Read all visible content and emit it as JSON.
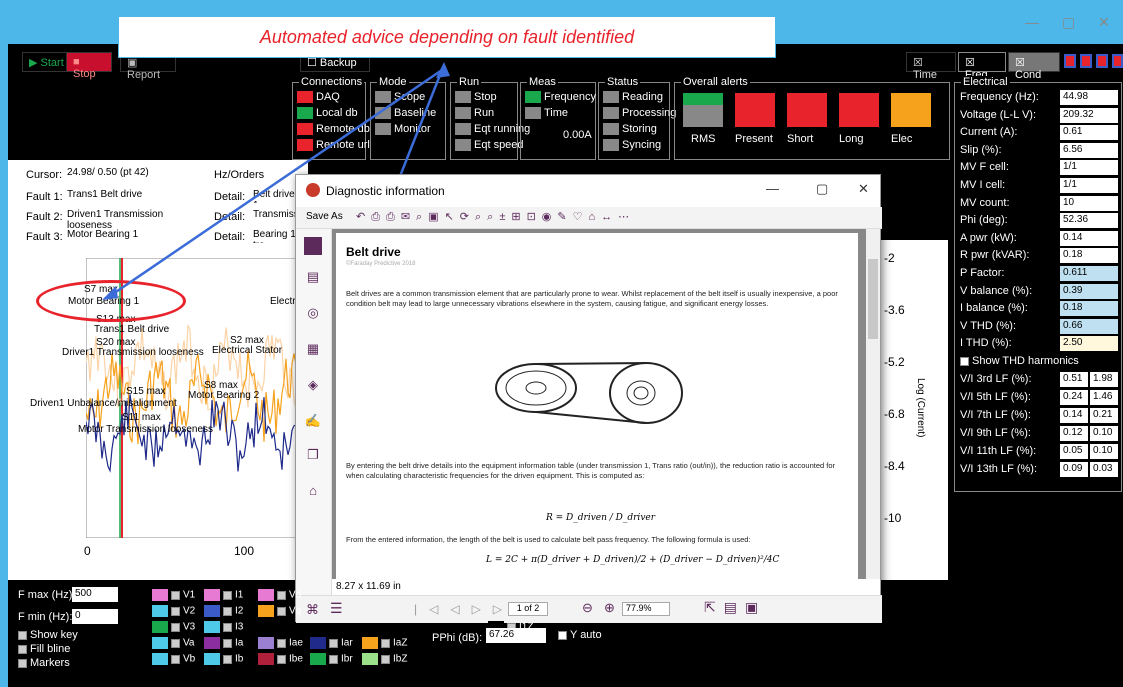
{
  "window": {
    "min": "—",
    "max": "▢",
    "close": "✕"
  },
  "toolbar": {
    "start": "▶ Start",
    "stop": "■ Stop",
    "report": "▣ Report",
    "backup": "☐ Backup",
    "time": "☒ Time",
    "freq": "☒ Freq",
    "cond": "☒ Cond"
  },
  "callout": "Automated advice depending on fault identified",
  "connections": {
    "title": "Connections",
    "items": [
      {
        "label": "DAQ",
        "color": "#e8232b"
      },
      {
        "label": "Local db",
        "color": "#1aa84d"
      },
      {
        "label": "Remote db",
        "color": "#e8232b"
      },
      {
        "label": "Remote url",
        "color": "#e8232b"
      }
    ]
  },
  "mode": {
    "title": "Mode",
    "items": [
      "Scope",
      "Baseline",
      "Monitor"
    ]
  },
  "run": {
    "title": "Run",
    "items": [
      "Stop",
      "Run",
      "Eqt running",
      "Eqt speed"
    ]
  },
  "meas": {
    "title": "Meas",
    "items": [
      "Frequency",
      "Time"
    ],
    "value": "0.00A"
  },
  "status": {
    "title": "Status",
    "items": [
      "Reading",
      "Processing",
      "Storing",
      "Syncing"
    ]
  },
  "alerts": {
    "title": "Overall alerts",
    "items": [
      {
        "label": "RMS",
        "color": "#888"
      },
      {
        "label": "Present",
        "color": "#e8232b"
      },
      {
        "label": "Short",
        "color": "#e8232b"
      },
      {
        "label": "Long",
        "color": "#e8232b"
      },
      {
        "label": "Elec",
        "color": "#f6a21d"
      }
    ]
  },
  "cursor": {
    "label": "Cursor:",
    "value": "24.98/ 0.50 (pt 42)",
    "unit": "Hz/Orders"
  },
  "faults": [
    {
      "label": "Fault 1:",
      "value": "Trans1 Belt drive",
      "detail": "Belt drive 1"
    },
    {
      "label": "Fault 2:",
      "value": "Driven1 Transmission looseness",
      "detail": "Transmissio"
    },
    {
      "label": "Fault 3:",
      "value": "Motor Bearing 1",
      "detail": "Bearing 1 tra"
    }
  ],
  "detail_label": "Detail:",
  "plot": {
    "annotations": [
      "S7 max",
      "Motor Bearing 1",
      "S13 max",
      "Trans1 Belt drive",
      "S20 max",
      "Driver1 Transmission looseness",
      "S2 max",
      "Electrical Stator",
      "S8 max",
      "Motor Bearing 2",
      "S15 max",
      "Driven1 Unbalance/misalignment",
      "S11 max",
      "Motor Transmission looseness",
      "Electr"
    ],
    "xticks": [
      "0",
      "100"
    ],
    "yticks": [
      "-2",
      "-3.6",
      "-5.2",
      "-6.8",
      "-8.4",
      "-10"
    ],
    "ylabel": "Log (Current)"
  },
  "pdf": {
    "title": "Diagnostic information",
    "save_as": "Save As",
    "heading": "Belt drive",
    "copyright": "©Faraday Predictive 2018",
    "para1": "Belt drives are a common transmission element that are particularly prone to wear. Whilst replacement of the belt itself is usually inexpensive, a poor condition belt may lead to large unnecessary vibrations elsewhere in the system, causing fatigue, and significant energy losses.",
    "para2": "By entering the belt drive details into the equipment information table (under transmission 1, Trans ratio (out/in)), the reduction ratio is accounted for when calculating characteristic frequencies for the driven equipment. This is computed as:",
    "formula1": "R = D_driven / D_driver",
    "para3": "From the entered information, the length of the belt is used to calculate belt pass frequency. The following formula is used:",
    "formula2": "L = 2C + π(D_driver + D_driven)/2 + (D_driver − D_driven)²/4C",
    "page_size": "8.27 x 11.69 in",
    "page": "1 of 2",
    "zoom": "77.9%"
  },
  "electrical": {
    "title": "Electrical",
    "rows": [
      {
        "label": "Frequency (Hz):",
        "value": "44.98",
        "bg": "#fff"
      },
      {
        "label": "Voltage (L-L V):",
        "value": "209.32",
        "bg": "#fff"
      },
      {
        "label": "Current (A):",
        "value": "0.61",
        "bg": "#fff"
      },
      {
        "label": "Slip (%):",
        "value": "6.56",
        "bg": "#fff"
      },
      {
        "label": "MV F cell:",
        "value": "1/1",
        "bg": "#fff"
      },
      {
        "label": "MV I cell:",
        "value": "1/1",
        "bg": "#fff"
      },
      {
        "label": "MV count:",
        "value": "10",
        "bg": "#fff"
      },
      {
        "label": "Phi (deg):",
        "value": "52.36",
        "bg": "#fff"
      },
      {
        "label": "A pwr (kW):",
        "value": "0.14",
        "bg": "#fff"
      },
      {
        "label": "R pwr (kVAR):",
        "value": "0.18",
        "bg": "#fff"
      },
      {
        "label": "P Factor:",
        "value": "0.611",
        "bg": "#bfe0f0"
      },
      {
        "label": "V balance (%):",
        "value": "0.39",
        "bg": "#bfe0f0"
      },
      {
        "label": "I balance (%):",
        "value": "0.18",
        "bg": "#bfe0f0"
      },
      {
        "label": "V THD (%):",
        "value": "0.66",
        "bg": "#bfe0f0"
      },
      {
        "label": "I THD (%):",
        "value": "2.50",
        "bg": "#fff8dc"
      }
    ],
    "show_thd": "Show THD harmonics",
    "harmonics": [
      {
        "label": "V/I 3rd LF (%):",
        "v": "0.51",
        "i": "1.98"
      },
      {
        "label": "V/I 5th LF (%):",
        "v": "0.24",
        "i": "1.46"
      },
      {
        "label": "V/I 7th LF (%):",
        "v": "0.14",
        "i": "0.21"
      },
      {
        "label": "V/I 9th LF (%):",
        "v": "0.12",
        "i": "0.10"
      },
      {
        "label": "V/I 11th LF (%):",
        "v": "0.05",
        "i": "0.10"
      },
      {
        "label": "V/I 13th LF (%):",
        "v": "0.09",
        "i": "0.03"
      }
    ]
  },
  "bottom": {
    "fmax_label": "F max (Hz):",
    "fmax": "500",
    "fmin_label": "F min (Hz):",
    "fmin": "0",
    "show_key": "Show key",
    "fill_bline": "Fill bline",
    "markers": "Markers",
    "pphi_label": "PPhi (dB):",
    "pphi": "67.26",
    "yauto": "Y auto",
    "legend": [
      {
        "label": "V1",
        "color": "#e77bd3"
      },
      {
        "label": "I1",
        "color": "#e77bd3"
      },
      {
        "label": "Vd",
        "color": "#e77bd3"
      },
      {
        "label": "V2",
        "color": "#4fc9e8"
      },
      {
        "label": "I2",
        "color": "#3b5bc9"
      },
      {
        "label": "Vq",
        "color": "#f6a21d"
      },
      {
        "label": "V3",
        "color": "#1aa84d"
      },
      {
        "label": "I3",
        "color": "#4fc9e8"
      },
      {
        "label": "I1Z",
        "color": "#000"
      },
      {
        "label": "Va",
        "color": "#4fc9e8"
      },
      {
        "label": "Ia",
        "color": "#8b2fa0"
      },
      {
        "label": "Iae",
        "color": "#9b7fd0"
      },
      {
        "label": "Iar",
        "color": "#1f2a8a"
      },
      {
        "label": "IaZ",
        "color": "#f6a21d"
      },
      {
        "label": "Vb",
        "color": "#4fc9e8"
      },
      {
        "label": "Ib",
        "color": "#4fc9e8"
      },
      {
        "label": "Ibe",
        "color": "#b0203a"
      },
      {
        "label": "Ibr",
        "color": "#1aa84d"
      },
      {
        "label": "IbZ",
        "color": "#9be08a"
      }
    ]
  }
}
